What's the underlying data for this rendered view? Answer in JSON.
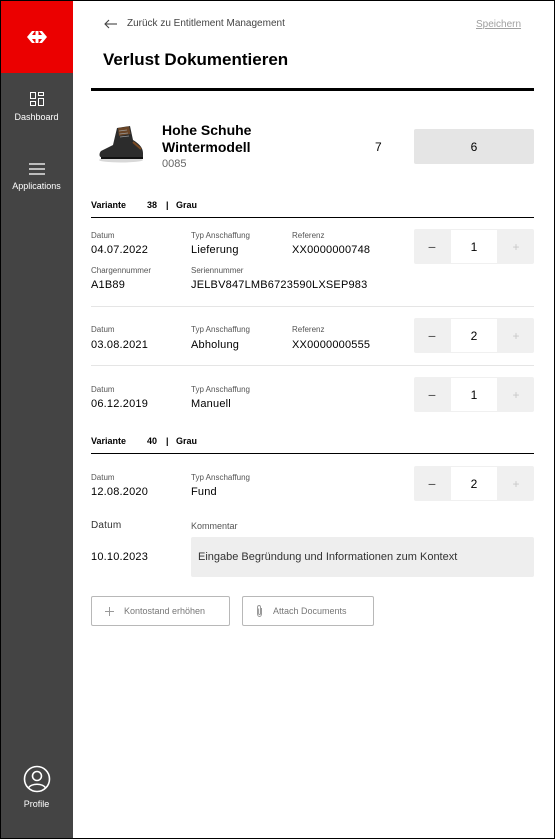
{
  "sidebar": {
    "items": [
      {
        "label": "Dashboard",
        "icon": "dashboard-icon"
      },
      {
        "label": "Applications",
        "icon": "menu-icon"
      },
      {
        "label": "Profile",
        "icon": "user-icon"
      }
    ],
    "logo_color": "#eb0000",
    "background": "#444444"
  },
  "header": {
    "back_label": "Zurück zu Entitlement Management",
    "save_label": "Speichern",
    "title": "Verlust Dokumentieren"
  },
  "product": {
    "name_line1": "Hohe Schuhe",
    "name_line2": "Wintermodell",
    "code": "0085",
    "stock": "7",
    "target": "6"
  },
  "variants": [
    {
      "label": "Variante",
      "size": "38",
      "separator": "|",
      "color": "Grau",
      "entries": [
        {
          "datum_label": "Datum",
          "datum": "04.07.2022",
          "typ_label": "Typ Anschaffung",
          "typ": "Lieferung",
          "ref_label": "Referenz",
          "ref": "XX0000000748",
          "charge_label": "Chargennummer",
          "charge": "A1B89",
          "serial_label": "Seriennummer",
          "serial": "JELBV847LMB6723590LXSEP983",
          "qty": "1"
        },
        {
          "datum_label": "Datum",
          "datum": "03.08.2021",
          "typ_label": "Typ Anschaffung",
          "typ": "Abholung",
          "ref_label": "Referenz",
          "ref": "XX0000000555",
          "qty": "2"
        },
        {
          "datum_label": "Datum",
          "datum": "06.12.2019",
          "typ_label": "Typ Anschaffung",
          "typ": "Manuell",
          "qty": "1"
        }
      ]
    },
    {
      "label": "Variante",
      "size": "40",
      "separator": "|",
      "color": "Grau",
      "entries": [
        {
          "datum_label": "Datum",
          "datum": "12.08.2020",
          "typ_label": "Typ Anschaffung",
          "typ": "Fund",
          "qty": "2"
        }
      ]
    }
  ],
  "stepper": {
    "minus": "−",
    "plus": "+"
  },
  "comment": {
    "datum_label": "Datum",
    "datum": "10.10.2023",
    "kommentar_label": "Kommentar",
    "placeholder": "Eingabe Begründung und Informationen zum Kontext"
  },
  "buttons": {
    "raise_label": "Kontostand erhöhen",
    "attach_label": "Attach Documents"
  }
}
